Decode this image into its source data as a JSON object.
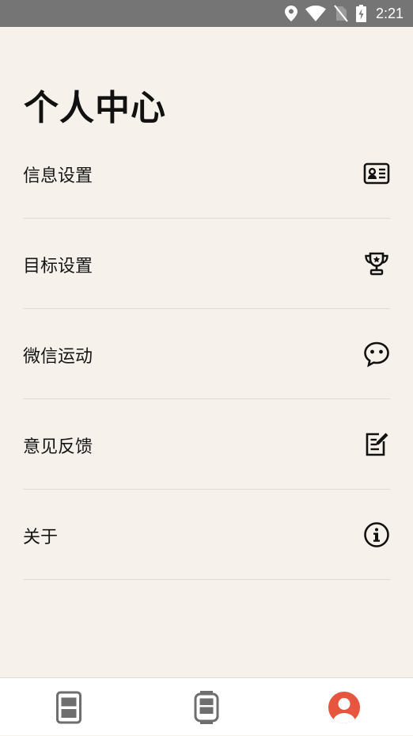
{
  "status_bar": {
    "time": "2:21",
    "icons": [
      "location-icon",
      "wifi-icon",
      "no-sim-icon",
      "battery-charging-icon"
    ]
  },
  "page": {
    "title": "个人中心"
  },
  "menu": {
    "items": [
      {
        "label": "信息设置",
        "icon": "id-card-icon"
      },
      {
        "label": "目标设置",
        "icon": "trophy-icon"
      },
      {
        "label": "微信运动",
        "icon": "wechat-icon"
      },
      {
        "label": "意见反馈",
        "icon": "feedback-edit-icon"
      },
      {
        "label": "关于",
        "icon": "info-icon"
      }
    ]
  },
  "bottom_nav": {
    "tabs": [
      {
        "icon": "phone-tab-icon",
        "active": false
      },
      {
        "icon": "watch-tab-icon",
        "active": false
      },
      {
        "icon": "profile-tab-icon",
        "active": true
      }
    ],
    "active_color": "#e8553e",
    "inactive_color": "#6e6e6e"
  },
  "colors": {
    "background": "#f6f2eb",
    "status_bar": "#757575"
  }
}
